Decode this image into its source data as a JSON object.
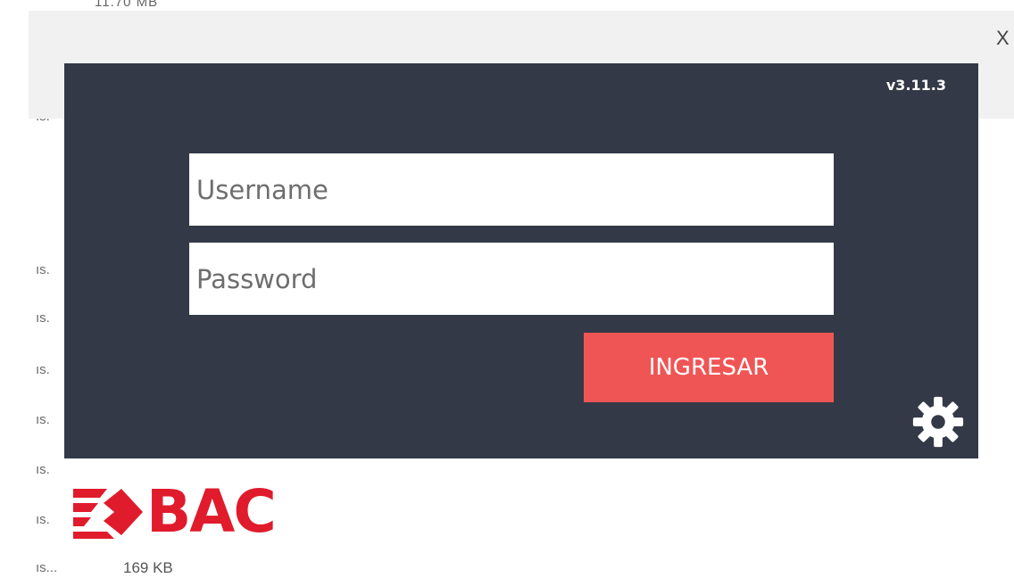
{
  "background": {
    "top_text": "11.70 MB",
    "row_labels": [
      "ıs.",
      "ıs.",
      "ıs.",
      "ıs.",
      "ıs.",
      "ıs.",
      "ıs.",
      "ıs..."
    ],
    "file_size": "169 KB"
  },
  "outer_dialog": {
    "close_label": "X"
  },
  "login": {
    "version": "v3.11.3",
    "username_placeholder": "Username",
    "password_placeholder": "Password",
    "submit_label": "INGRESAR",
    "settings_icon": "gear-icon",
    "accent_color": "#f05555",
    "panel_color": "#343947"
  },
  "brand": {
    "logo_text": "BAC",
    "logo_color": "#e01b2c"
  }
}
